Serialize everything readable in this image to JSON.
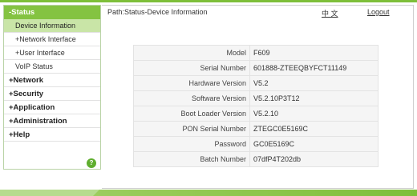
{
  "sidebar": {
    "status": "-Status",
    "device_information": "Device Information",
    "network_interface": "+Network Interface",
    "user_interface": "+User Interface",
    "voip_status": "VoIP Status",
    "network": "+Network",
    "security": "+Security",
    "application": "+Application",
    "administration": "+Administration",
    "help": "+Help",
    "help_badge": "?"
  },
  "header": {
    "path": "Path:Status-Device Information",
    "language": "中 文",
    "logout": "Logout"
  },
  "device_info": {
    "rows": [
      {
        "label": "Model",
        "value": "F609"
      },
      {
        "label": "Serial Number",
        "value": "601888-ZTEEQBYFCT11149"
      },
      {
        "label": "Hardware Version",
        "value": "V5.2"
      },
      {
        "label": "Software Version",
        "value": "V5.2.10P3T12"
      },
      {
        "label": "Boot Loader Version",
        "value": "V5.2.10"
      },
      {
        "label": "PON Serial Number",
        "value": "ZTEGC0E5169C"
      },
      {
        "label": "Password",
        "value": "GC0E5169C"
      },
      {
        "label": "Batch Number",
        "value": "07dfP4T202db"
      }
    ]
  },
  "colors": {
    "accent_green": "#84c341",
    "active_item": "#c9e5a7"
  }
}
